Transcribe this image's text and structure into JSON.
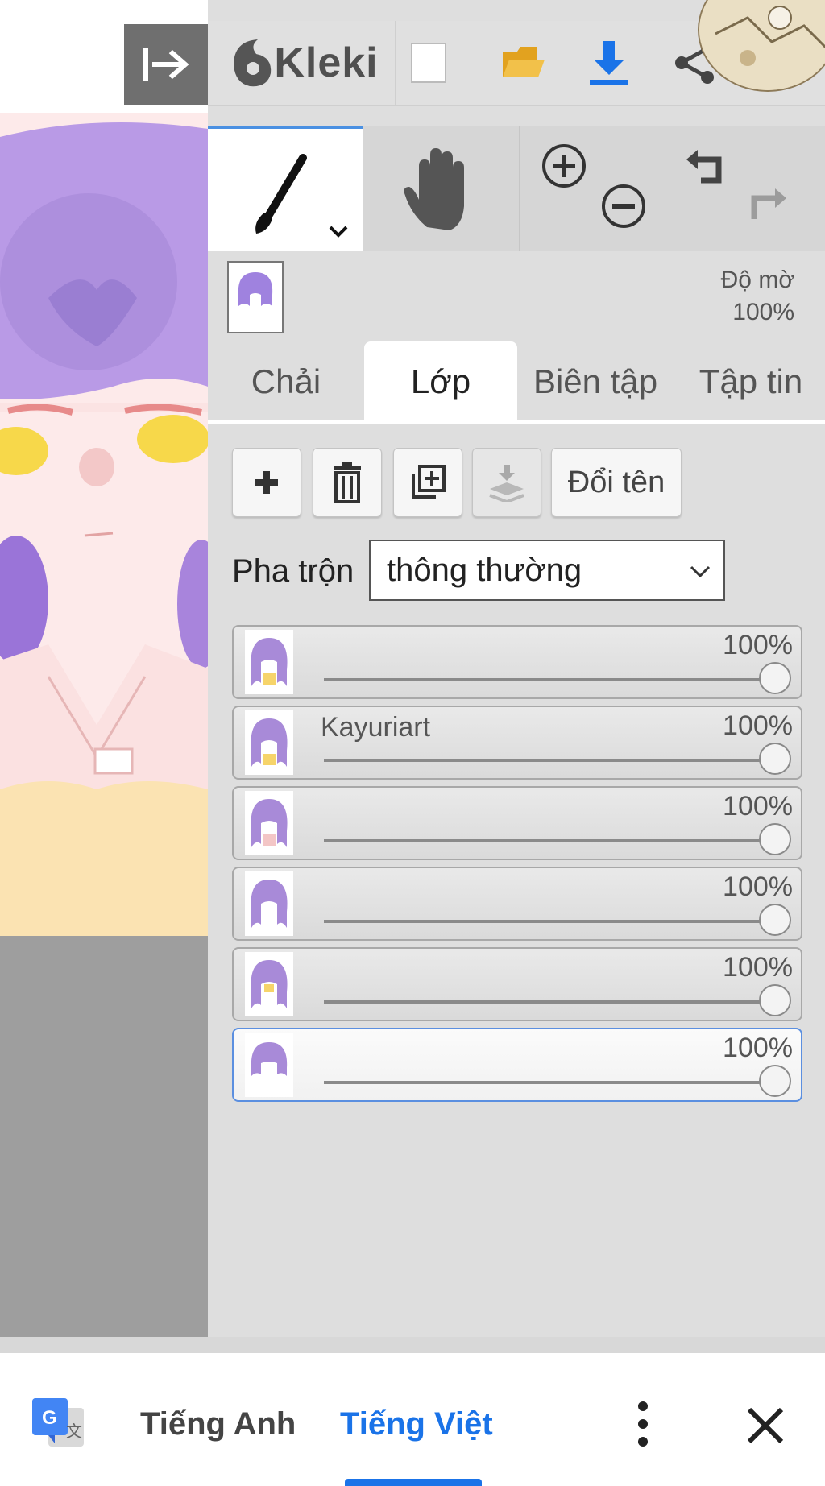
{
  "app": {
    "name": "Kleki",
    "collapse_icon": "collapse-panel-icon"
  },
  "toolbar": {
    "new_icon": "new-file-icon",
    "open_icon": "open-folder-icon",
    "save_icon": "download-icon",
    "share_icon": "share-icon",
    "accent_color": "#1a73e8"
  },
  "tools": {
    "brush_icon": "brush-icon",
    "hand_icon": "hand-icon",
    "zoom_in_icon": "zoom-in-icon",
    "zoom_out_icon": "zoom-out-icon",
    "undo_icon": "undo-icon",
    "redo_icon": "redo-icon"
  },
  "layer_header": {
    "opacity_label": "Độ mờ",
    "opacity_value": "100%"
  },
  "tabs": [
    {
      "label": "Chải"
    },
    {
      "label": "Lớp",
      "active": true
    },
    {
      "label": "Biên tập"
    },
    {
      "label": "Tập tin"
    }
  ],
  "layer_actions": {
    "add_icon": "plus-icon",
    "delete_icon": "trash-icon",
    "duplicate_icon": "duplicate-icon",
    "merge_icon": "merge-down-icon",
    "rename_label": "Đổi tên"
  },
  "blend": {
    "label": "Pha trộn",
    "value": "thông thường"
  },
  "layers": [
    {
      "name": "",
      "opacity": "100%",
      "opacity_value": 1.0
    },
    {
      "name": "Kayuriart",
      "opacity": "100%",
      "opacity_value": 1.0
    },
    {
      "name": "",
      "opacity": "100%",
      "opacity_value": 1.0
    },
    {
      "name": "",
      "opacity": "100%",
      "opacity_value": 1.0
    },
    {
      "name": "",
      "opacity": "100%",
      "opacity_value": 1.0
    },
    {
      "name": "",
      "opacity": "100%",
      "opacity_value": 1.0,
      "active": true
    }
  ],
  "translate_bar": {
    "icon": "google-translate-icon",
    "lang_source": "Tiếng Anh",
    "lang_target": "Tiếng Việt",
    "more_icon": "more-vert-icon",
    "close_icon": "close-icon"
  }
}
